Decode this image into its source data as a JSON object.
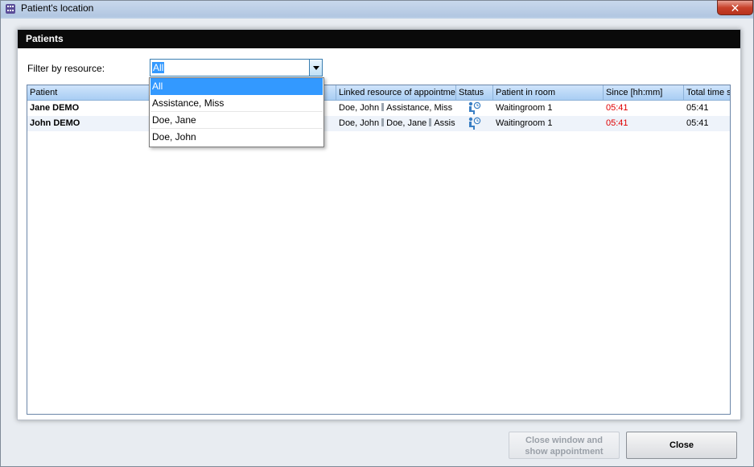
{
  "window": {
    "title": "Patient's location",
    "close_glyph": "✕"
  },
  "panel": {
    "header": "Patients"
  },
  "filter": {
    "label": "Filter by resource:",
    "selected": "All",
    "options": [
      "All",
      "Assistance, Miss",
      "Doe, Jane",
      "Doe, John"
    ]
  },
  "grid": {
    "columns": [
      "Patient",
      "Linked resource of appointme",
      "Status",
      "Patient in room",
      "Since [hh:mm]",
      "Total time s"
    ],
    "rows": [
      {
        "patient": "Jane DEMO",
        "linked_a": "Doe, John",
        "linked_b": "Assistance, Miss",
        "status_icon": "waiting-patient-icon",
        "room": "Waitingroom 1",
        "since": "05:41",
        "total": "05:41"
      },
      {
        "patient": "John DEMO",
        "linked_a": "Doe, John",
        "linked_b": "Doe, Jane",
        "linked_c": "Assis",
        "status_icon": "waiting-patient-icon",
        "room": "Waitingroom 1",
        "since": "05:41",
        "total": "05:41"
      }
    ]
  },
  "buttons": {
    "show_line1": "Close window and",
    "show_line2": "show appointment",
    "close": "Close"
  },
  "colors": {
    "accent": "#3399ff",
    "since_red": "#e00000",
    "header_black": "#0a0a0a"
  }
}
